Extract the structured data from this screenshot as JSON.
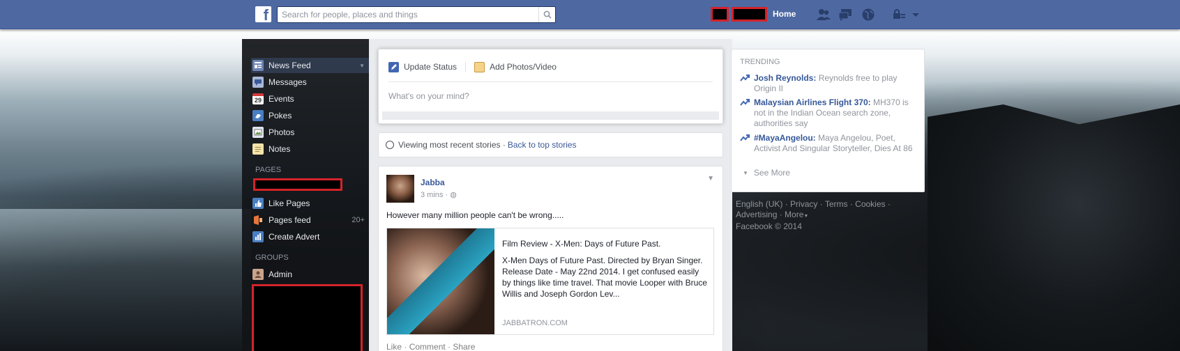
{
  "topbar": {
    "search_placeholder": "Search for people, places and things",
    "home_label": "Home",
    "logo_letter": "f"
  },
  "sidebar": {
    "items": [
      {
        "label": "News Feed",
        "icon": "news-feed-icon"
      },
      {
        "label": "Messages",
        "icon": "messages-icon"
      },
      {
        "label": "Events",
        "icon": "events-icon",
        "icon_text": "29"
      },
      {
        "label": "Pokes",
        "icon": "pokes-icon"
      },
      {
        "label": "Photos",
        "icon": "photos-icon"
      },
      {
        "label": "Notes",
        "icon": "notes-icon"
      }
    ],
    "pages_head": "PAGES",
    "pages_items": [
      {
        "label": "Like Pages",
        "icon": "like-pages-icon"
      },
      {
        "label": "Pages feed",
        "icon": "pages-feed-icon",
        "count": "20+"
      },
      {
        "label": "Create Advert",
        "icon": "create-advert-icon"
      }
    ],
    "groups_head": "GROUPS",
    "groups_items": [
      {
        "label": "Admin",
        "icon": "group-icon"
      }
    ]
  },
  "composer": {
    "update_status": "Update Status",
    "add_photos": "Add Photos/Video",
    "placeholder": "What's on your mind?"
  },
  "viewing": {
    "text": "Viewing most recent stories ·",
    "link": "Back to top stories"
  },
  "post": {
    "author": "Jabba",
    "time": "3 mins ·",
    "text": "However many million people can't be wrong.....",
    "link_title": "Film Review - X-Men: Days of Future Past.",
    "link_desc": "X-Men Days of Future Past. Directed by Bryan Singer. Release Date - May 22nd 2014. I get confused easily by things like time travel. That movie Looper with Bruce Willis and Joseph Gordon Lev...",
    "link_domain": "JABBATRON.COM",
    "actions": [
      "Like",
      "Comment",
      "Share"
    ]
  },
  "trending": {
    "head": "TRENDING",
    "items": [
      {
        "name": "Josh Reynolds:",
        "desc": "Reynolds free to play Origin II"
      },
      {
        "name": "Malaysian Airlines Flight 370:",
        "desc": "MH370 is not in the Indian Ocean search zone, authorities say"
      },
      {
        "name": "#MayaAngelou:",
        "desc": "Maya Angelou, Poet, Activist And Singular Storyteller, Dies At 86"
      }
    ],
    "see_more": "See More"
  },
  "footer": {
    "links": [
      "English (UK)",
      "Privacy",
      "Terms",
      "Cookies",
      "Advertising",
      "More"
    ],
    "copyright": "Facebook © 2014"
  },
  "colors": {
    "brand": "#4e69a2",
    "link": "#365899",
    "redaction_border": "#d4232a"
  }
}
